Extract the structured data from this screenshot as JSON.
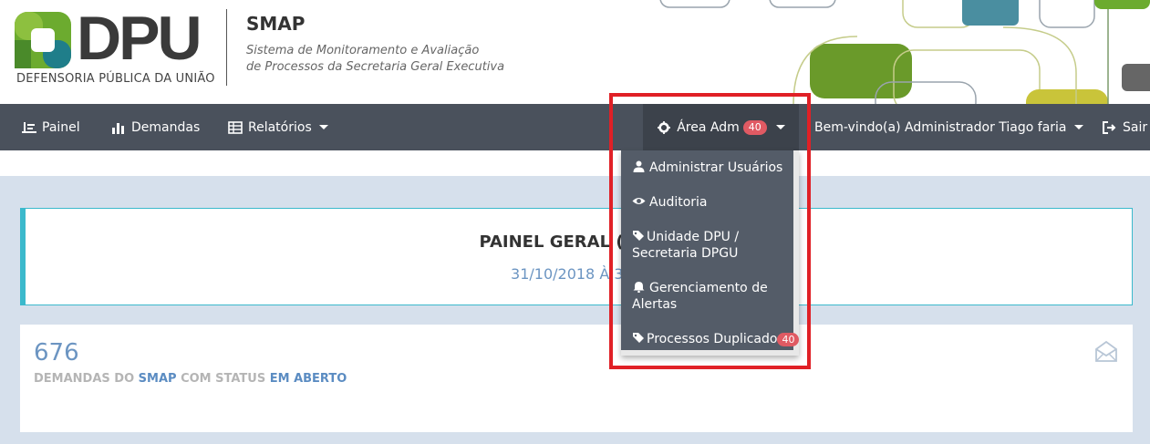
{
  "header": {
    "logo_text": "DPU",
    "logo_subtitle": "DEFENSORIA PÚBLICA DA UNIÃO",
    "system_title": "SMAP",
    "system_desc_line1": "Sistema de Monitoramento e Avaliação",
    "system_desc_line2": "de Processos da Secretaria Geral Executiva"
  },
  "navbar": {
    "painel": "Painel",
    "demandas": "Demandas",
    "relatorios": "Relatórios",
    "area_adm": "Área Adm",
    "area_adm_badge": "40",
    "welcome": "Bem-vindo(a) Administrador Tiago faria",
    "sair": "Sair"
  },
  "dropdown": {
    "items": [
      {
        "label": "Administrar Usuários",
        "icon": "user-icon"
      },
      {
        "label": "Auditoria",
        "icon": "eye-icon"
      },
      {
        "label": "Unidade DPU / Secretaria DPGU",
        "icon": "tags-icon"
      },
      {
        "label": "Gerenciamento de Alertas",
        "icon": "bell-icon"
      },
      {
        "label": "Processos Duplicado",
        "icon": "tags-icon",
        "badge": "40"
      }
    ]
  },
  "panel": {
    "title": "PAINEL GERAL (ÚLTIM",
    "date_range": "31/10/2018 À 30.1"
  },
  "stat": {
    "value": "676",
    "label_part1": "DEMANDAS DO ",
    "label_hl1": "SMAP",
    "label_part2": " COM STATUS ",
    "label_hl2": "EM ABERTO"
  },
  "colors": {
    "navbar": "#4a515c",
    "accent": "#3bb9cc",
    "badge": "#e05a63",
    "highlight": "#e02026"
  }
}
